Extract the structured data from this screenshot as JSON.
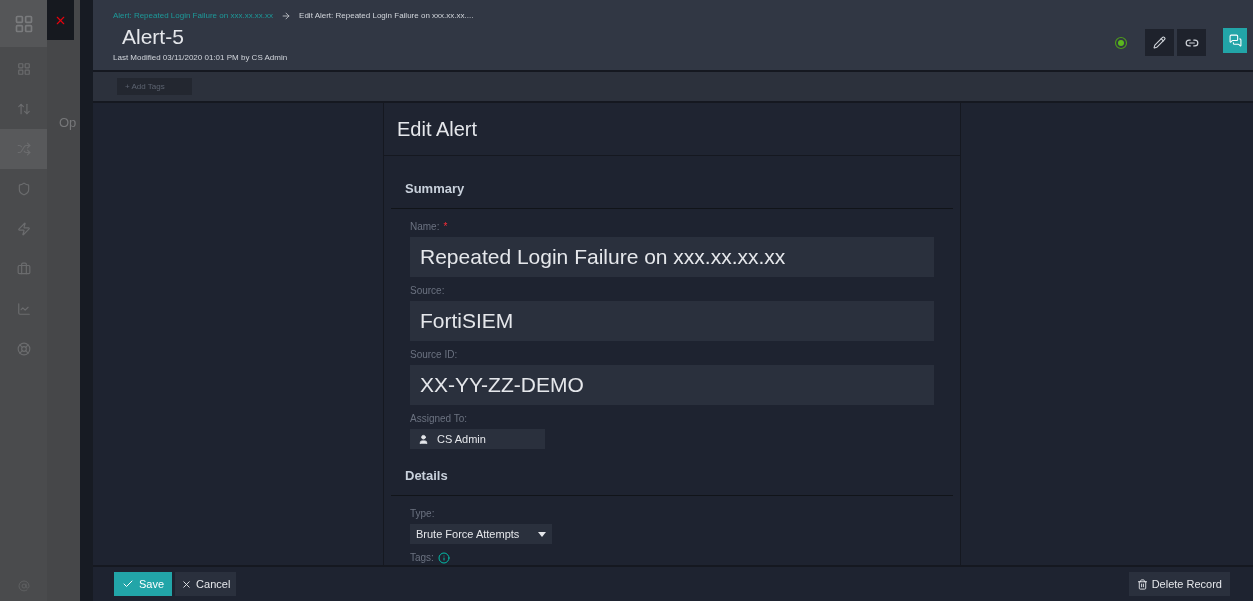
{
  "sidebar": {
    "items": [
      {
        "kind": "dashboard",
        "selected": false
      },
      {
        "kind": "sort",
        "selected": false
      },
      {
        "kind": "shuffle",
        "selected": true
      },
      {
        "kind": "shield",
        "selected": false
      },
      {
        "kind": "bolt",
        "selected": false
      },
      {
        "kind": "briefcase",
        "selected": false
      },
      {
        "kind": "chart",
        "selected": false
      },
      {
        "kind": "lifebuoy",
        "selected": false
      }
    ]
  },
  "background_page": {
    "heading": "Op"
  },
  "header": {
    "breadcrumbs": [
      {
        "text": "Alert: Repeated Login Failure on xxx.xx.xx.xx",
        "link": true
      },
      {
        "text": "Edit Alert: Repeated Login Failure on xxx.xx.xx....",
        "link": false
      }
    ],
    "title": "Alert-5",
    "modified": "Last Modified 03/11/2020 01:01 PM by CS Admin"
  },
  "tag_bar": {
    "add_tags": "+ Add Tags"
  },
  "form": {
    "title": "Edit Alert",
    "sections": [
      {
        "title": "Summary",
        "fields": [
          {
            "kind": "text",
            "label": "Name:",
            "required_mark": "*",
            "value": "Repeated Login Failure on xxx.xx.xx.xx"
          },
          {
            "kind": "text",
            "label": "Source:",
            "value": "FortiSIEM"
          },
          {
            "kind": "text",
            "label": "Source ID:",
            "value": "XX-YY-ZZ-DEMO"
          },
          {
            "kind": "user",
            "label": "Assigned To:",
            "value": "CS Admin"
          }
        ]
      },
      {
        "title": "Details",
        "fields": [
          {
            "kind": "select",
            "label": "Type:",
            "value": "Brute Force Attempts"
          },
          {
            "kind": "info",
            "label": "Tags:"
          }
        ]
      }
    ]
  },
  "footer": {
    "save": "Save",
    "cancel": "Cancel",
    "delete": "Delete Record"
  }
}
